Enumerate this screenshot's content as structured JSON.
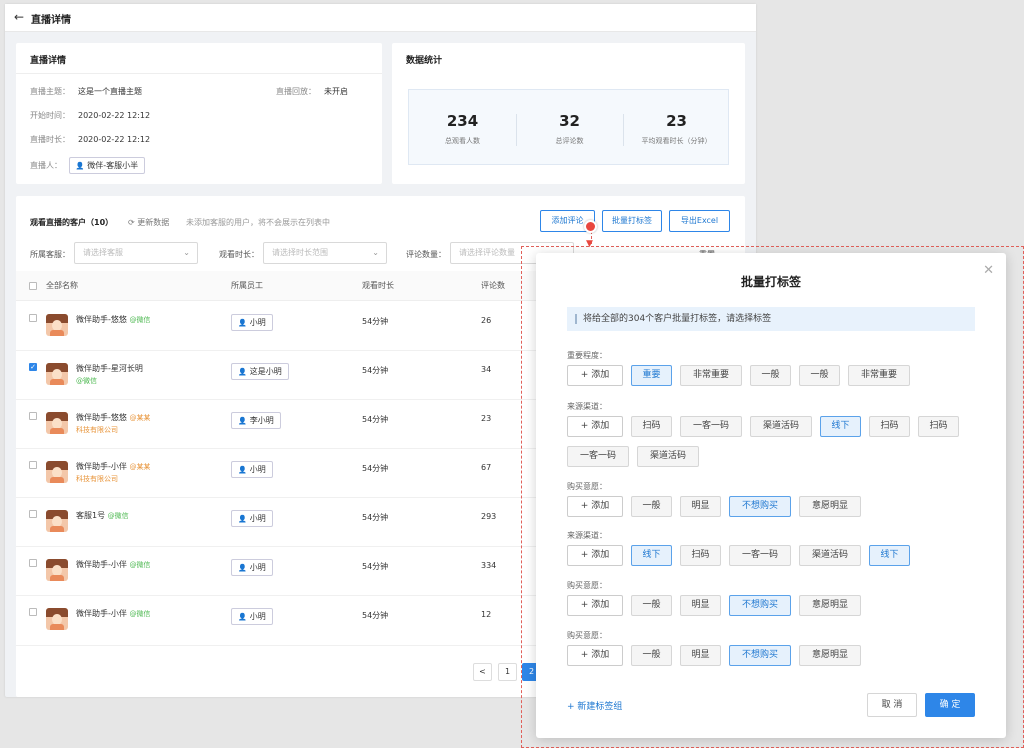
{
  "header": {
    "title": "直播详情"
  },
  "detail": {
    "title": "直播详情",
    "topic_label": "直播主题：",
    "topic": "这是一个直播主题",
    "replay_label": "直播回放：",
    "replay": "未开启",
    "start_label": "开始时间：",
    "start": "2020-02-22 12:12",
    "duration_label": "直播时长：",
    "duration": "2020-02-22 12:12",
    "host_label": "直播人：",
    "host": "微伴-客服小半"
  },
  "stats": {
    "title": "数据统计",
    "items": [
      {
        "value": "234",
        "label": "总观看人数"
      },
      {
        "value": "32",
        "label": "总评论数"
      },
      {
        "value": "23",
        "label": "平均观看时长（分钟）"
      }
    ]
  },
  "customers": {
    "title": "观看直播的客户（10）",
    "refresh": "更新数据",
    "note": "未添加客服的用户，将不会展示在列表中",
    "buttons": {
      "add_comment": "添加评论",
      "batch_tag": "批量打标签",
      "export": "导出Excel"
    },
    "filters": {
      "staff_label": "所属客服：",
      "staff_placeholder": "请选择客服",
      "time_label": "观看时长：",
      "time_placeholder": "请选择时长范围",
      "comment_label": "评论数量：",
      "comment_placeholder": "请选择评论数量",
      "reset": "重置"
    },
    "columns": [
      "全部名称",
      "所属员工",
      "观看时长",
      "评论数"
    ],
    "rows": [
      {
        "name": "微伴助手-悠悠",
        "tag": "@微信",
        "tag_type": "wx",
        "staff": "小明",
        "time": "54分钟",
        "comments": "26",
        "checked": false
      },
      {
        "name": "微伴助手-星河长明",
        "tag": "@微信",
        "tag_type": "wx",
        "staff": "这是小明",
        "time": "54分钟",
        "comments": "34",
        "checked": true
      },
      {
        "name": "微伴助手-悠悠",
        "tag": "@某某科技有限公司",
        "tag_type": "org",
        "staff": "李小明",
        "time": "54分钟",
        "comments": "23",
        "checked": false
      },
      {
        "name": "微伴助手-小伴",
        "tag": "@某某科技有限公司",
        "tag_type": "org",
        "staff": "小明",
        "time": "54分钟",
        "comments": "67",
        "checked": false
      },
      {
        "name": "客服1号",
        "tag": "@微信",
        "tag_type": "wx",
        "staff": "小明",
        "time": "54分钟",
        "comments": "293",
        "checked": false
      },
      {
        "name": "微伴助手-小伴",
        "tag": "@微信",
        "tag_type": "wx",
        "staff": "小明",
        "time": "54分钟",
        "comments": "334",
        "checked": false
      },
      {
        "name": "微伴助手-小伴",
        "tag": "@微信",
        "tag_type": "wx",
        "staff": "小明",
        "time": "54分钟",
        "comments": "12",
        "checked": false
      }
    ],
    "pagination": [
      "1",
      "2"
    ]
  },
  "modal": {
    "title": "批量打标签",
    "notice": "将给全部的304个客户批量打标签，请选择标签",
    "add_label": "+ 添加",
    "groups": [
      {
        "label": "重要程度：",
        "tags": [
          {
            "t": "重要",
            "s": true
          },
          {
            "t": "非常重要",
            "s": false
          },
          {
            "t": "一般",
            "s": false
          },
          {
            "t": "一般",
            "s": false
          },
          {
            "t": "非常重要",
            "s": false
          }
        ]
      },
      {
        "label": "来源渠道：",
        "tags": [
          {
            "t": "扫码",
            "s": false
          },
          {
            "t": "一客一码",
            "s": false
          },
          {
            "t": "渠道活码",
            "s": false
          },
          {
            "t": "线下",
            "s": true
          },
          {
            "t": "扫码",
            "s": false
          },
          {
            "t": "扫码",
            "s": false
          },
          {
            "t": "一客一码",
            "s": false
          },
          {
            "t": "渠道活码",
            "s": false
          }
        ]
      },
      {
        "label": "购买意愿：",
        "tags": [
          {
            "t": "一般",
            "s": false
          },
          {
            "t": "明显",
            "s": false
          },
          {
            "t": "不想购买",
            "s": true
          },
          {
            "t": "意愿明显",
            "s": false
          }
        ]
      },
      {
        "label": "来源渠道：",
        "tags": [
          {
            "t": "线下",
            "s": true
          },
          {
            "t": "扫码",
            "s": false
          },
          {
            "t": "一客一码",
            "s": false
          },
          {
            "t": "渠道活码",
            "s": false
          },
          {
            "t": "线下",
            "s": true
          }
        ]
      },
      {
        "label": "购买意愿：",
        "tags": [
          {
            "t": "一般",
            "s": false
          },
          {
            "t": "明显",
            "s": false
          },
          {
            "t": "不想购买",
            "s": true
          },
          {
            "t": "意愿明显",
            "s": false
          }
        ]
      },
      {
        "label": "购买意愿：",
        "tags": [
          {
            "t": "一般",
            "s": false
          },
          {
            "t": "明显",
            "s": false
          },
          {
            "t": "不想购买",
            "s": true
          },
          {
            "t": "意愿明显",
            "s": false
          }
        ]
      }
    ],
    "new_group": "+ 新建标签组",
    "cancel": "取 消",
    "ok": "确 定"
  }
}
